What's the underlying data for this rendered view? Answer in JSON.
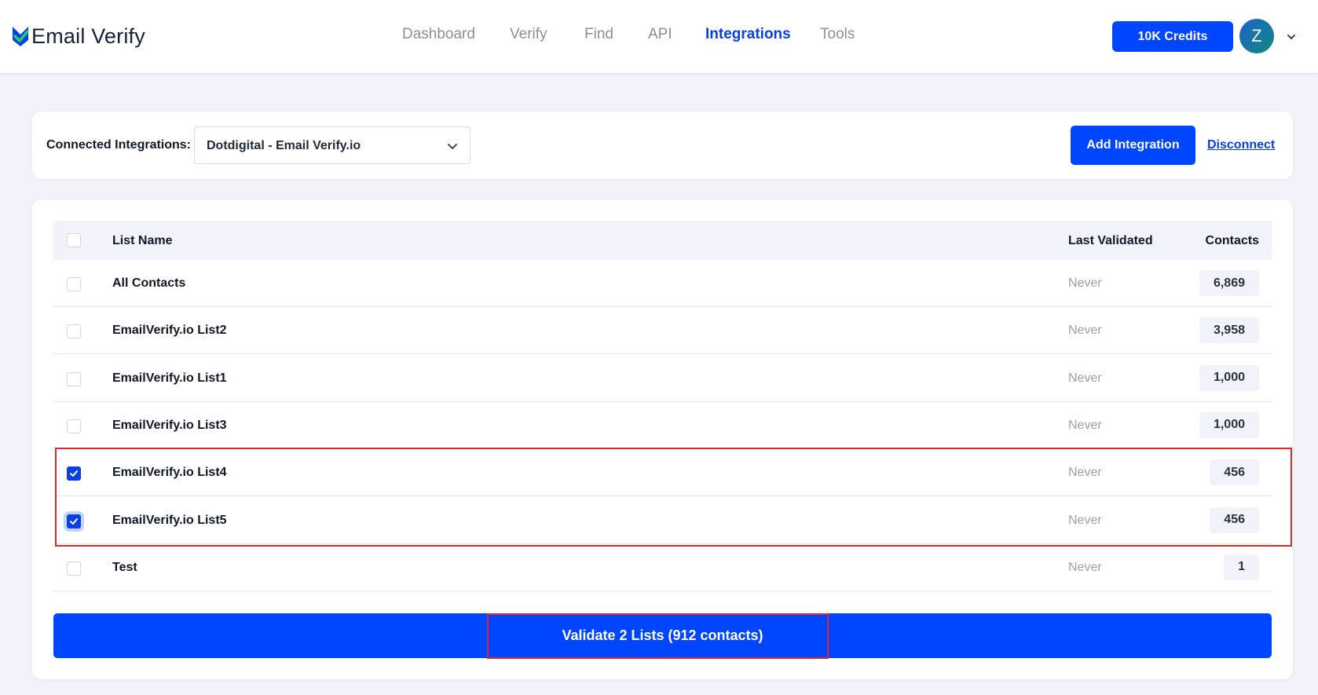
{
  "brand": {
    "name": "Email Verify"
  },
  "nav": [
    {
      "label": "Dashboard",
      "active": false
    },
    {
      "label": "Verify",
      "active": false
    },
    {
      "label": "Find",
      "active": false
    },
    {
      "label": "API",
      "active": false
    },
    {
      "label": "Integrations",
      "active": true
    },
    {
      "label": "Tools",
      "active": false
    }
  ],
  "header": {
    "credits_label": "10K Credits",
    "avatar_initial": "Z"
  },
  "integrations": {
    "connected_label": "Connected Integrations:",
    "selected": "Dotdigital - Email Verify.io",
    "add_label": "Add Integration",
    "disconnect_label": "Disconnect"
  },
  "table": {
    "columns": {
      "name": "List Name",
      "last_validated": "Last Validated",
      "contacts": "Contacts"
    },
    "rows": [
      {
        "name": "All Contacts",
        "last_validated": "Never",
        "contacts": "6,869",
        "checked": false
      },
      {
        "name": "EmailVerify.io List2",
        "last_validated": "Never",
        "contacts": "3,958",
        "checked": false
      },
      {
        "name": "EmailVerify.io List1",
        "last_validated": "Never",
        "contacts": "1,000",
        "checked": false
      },
      {
        "name": "EmailVerify.io List3",
        "last_validated": "Never",
        "contacts": "1,000",
        "checked": false
      },
      {
        "name": "EmailVerify.io List4",
        "last_validated": "Never",
        "contacts": "456",
        "checked": true
      },
      {
        "name": "EmailVerify.io List5",
        "last_validated": "Never",
        "contacts": "456",
        "checked": true
      },
      {
        "name": "Test",
        "last_validated": "Never",
        "contacts": "1",
        "checked": false
      }
    ]
  },
  "validate_label": "Validate 2 Lists (912 contacts)",
  "colors": {
    "primary": "#0046ff",
    "highlight": "#e0262f",
    "background": "#f1f2fa"
  }
}
